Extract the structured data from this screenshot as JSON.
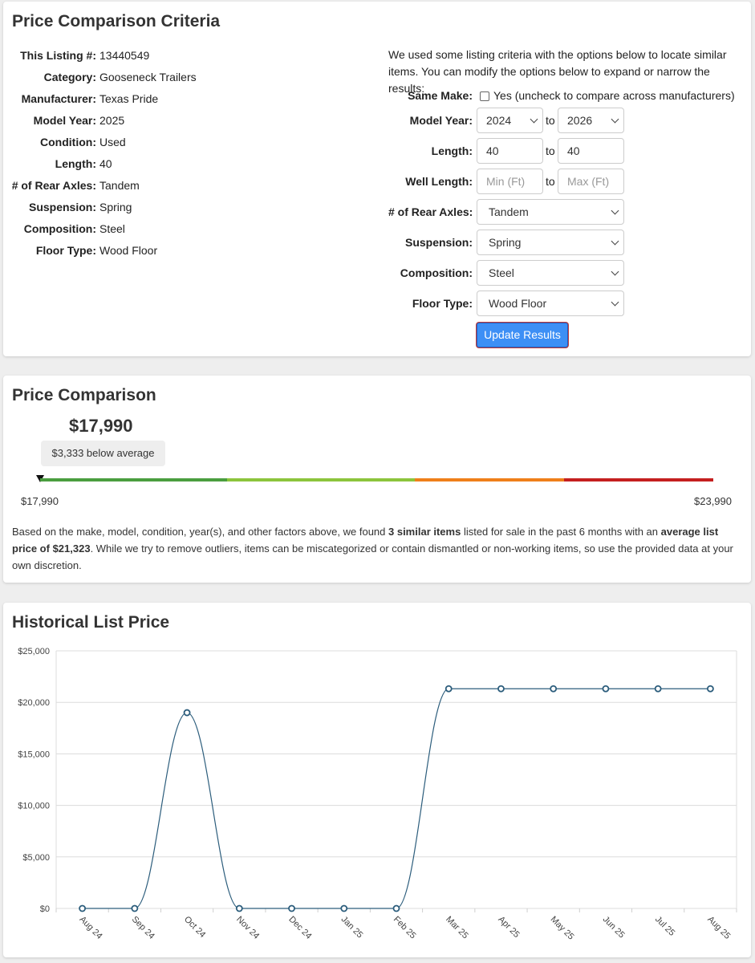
{
  "criteria": {
    "title": "Price Comparison Criteria",
    "listing": [
      {
        "label": "This Listing #:",
        "value": "13440549"
      },
      {
        "label": "Category:",
        "value": "Gooseneck Trailers"
      },
      {
        "label": "Manufacturer:",
        "value": "Texas Pride"
      },
      {
        "label": "Model Year:",
        "value": "2025"
      },
      {
        "label": "Condition:",
        "value": "Used"
      },
      {
        "label": "Length:",
        "value": "40"
      },
      {
        "label": "# of Rear Axles:",
        "value": "Tandem"
      },
      {
        "label": "Suspension:",
        "value": "Spring"
      },
      {
        "label": "Composition:",
        "value": "Steel"
      },
      {
        "label": "Floor Type:",
        "value": "Wood Floor"
      }
    ],
    "intro": "We used some listing criteria with the options below to locate similar items. You can modify the options below to expand or narrow the results:",
    "same_make": {
      "label": "Same Make:",
      "checkbox_label": "Yes (uncheck to compare across manufacturers)"
    },
    "model_year": {
      "label": "Model Year:",
      "from": "2024",
      "to": "2026",
      "to_text": "to"
    },
    "length": {
      "label": "Length:",
      "from": "40",
      "to": "40",
      "to_text": "to"
    },
    "well_length": {
      "label": "Well Length:",
      "from_placeholder": "Min (Ft)",
      "to_placeholder": "Max (Ft)",
      "to_text": "to"
    },
    "rear_axles": {
      "label": "# of Rear Axles:",
      "value": "Tandem"
    },
    "suspension": {
      "label": "Suspension:",
      "value": "Spring"
    },
    "composition": {
      "label": "Composition:",
      "value": "Steel"
    },
    "floor_type": {
      "label": "Floor Type:",
      "value": "Wood Floor"
    },
    "update_button": "Update Results"
  },
  "comparison": {
    "title": "Price Comparison",
    "price": "$17,990",
    "badge": "$3,333 below average",
    "min_label": "$17,990",
    "max_label": "$23,990",
    "summary_pre": "Based on the make, model, condition, year(s), and other factors above, we found ",
    "summary_count": "3 similar items",
    "summary_mid": " listed for sale in the past 6 months with an ",
    "summary_avg": "average list price of $21,323",
    "summary_post": ". While we try to remove outliers, items can be miscategorized or contain dismantled or non-working items, so use the provided data at your own discretion.",
    "bar_colors": [
      "#4a9e3f",
      "#8cc43c",
      "#ef7f1a",
      "#c41f1f"
    ]
  },
  "history": {
    "title": "Historical List Price"
  },
  "chart_data": {
    "type": "line",
    "title": "Historical List Price",
    "categories": [
      "Aug 24",
      "Sep 24",
      "Oct 24",
      "Nov 24",
      "Dec 24",
      "Jan 25",
      "Feb 25",
      "Mar 25",
      "Apr 25",
      "May 25",
      "Jun 25",
      "Jul 25",
      "Aug 25"
    ],
    "series": [
      {
        "values": [
          0,
          0,
          19000,
          0,
          0,
          0,
          0,
          21323,
          21323,
          21323,
          21323,
          21323,
          21323
        ]
      }
    ],
    "y_ticks": [
      "$0",
      "$5,000",
      "$10,000",
      "$15,000",
      "$20,000",
      "$25,000"
    ],
    "ylim": [
      0,
      25000
    ],
    "grid": true,
    "line_color": "#2c5d7c"
  }
}
